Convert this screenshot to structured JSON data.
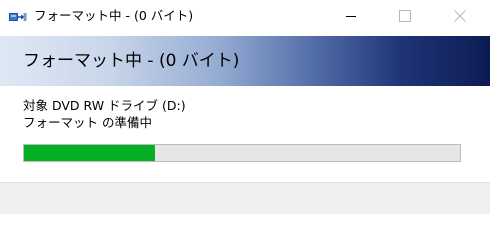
{
  "window": {
    "title": "フォーマット中 - (0 バイト)",
    "icon": "format-drive-icon"
  },
  "banner": {
    "heading": "フォーマット中 - (0 バイト)"
  },
  "content": {
    "target_label": "対象 DVD RW ドライブ (D:)",
    "status": "フォーマット の準備中"
  },
  "progress": {
    "fraction": 0.3
  },
  "colors": {
    "progress_fill": "#06b025",
    "progress_track": "#e6e6e6",
    "banner_dark": "#0c1c52",
    "banner_light": "#dfe8f4"
  },
  "controls": {
    "minimize_icon": "minimize-icon",
    "maximize_icon": "maximize-icon",
    "close_icon": "close-icon"
  }
}
